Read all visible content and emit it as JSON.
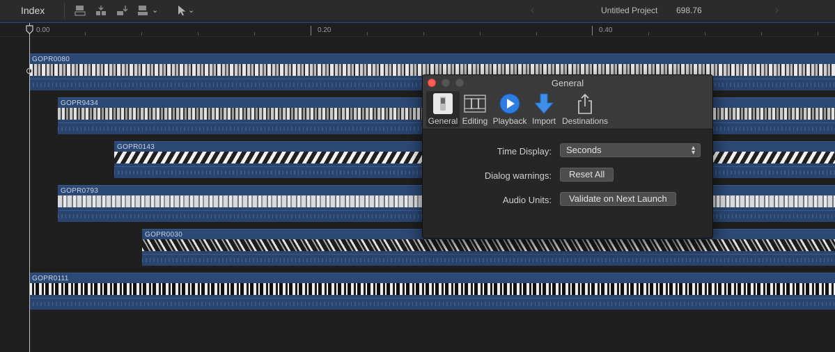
{
  "toolbar": {
    "index_label": "Index",
    "project_title": "Untitled Project",
    "project_duration": "698.76",
    "icons": [
      "connect-clip-icon",
      "insert-clip-icon",
      "append-clip-icon",
      "overwrite-clip-icon",
      "select-tool-icon"
    ]
  },
  "ruler": {
    "marks": [
      "0.00",
      "0.20",
      "0.40"
    ]
  },
  "clips": [
    {
      "name": "GOPR0080"
    },
    {
      "name": "GOPR9434"
    },
    {
      "name": "GOPR0143"
    },
    {
      "name": "GOPR0793"
    },
    {
      "name": "GOPR0030"
    },
    {
      "name": "GOPR0111"
    }
  ],
  "preferences": {
    "title": "General",
    "tabs": [
      {
        "label": "General",
        "icon": "switch-icon",
        "active": true
      },
      {
        "label": "Editing",
        "icon": "film-editing-icon"
      },
      {
        "label": "Playback",
        "icon": "play-icon"
      },
      {
        "label": "Import",
        "icon": "import-arrow-icon"
      },
      {
        "label": "Destinations",
        "icon": "share-icon"
      }
    ],
    "time_display": {
      "label": "Time Display:",
      "value": "Seconds"
    },
    "dialog_warnings": {
      "label": "Dialog warnings:",
      "button": "Reset All"
    },
    "audio_units": {
      "label": "Audio Units:",
      "button": "Validate on Next Launch"
    }
  },
  "colors": {
    "clip_blue": "#2c4874",
    "toolbar_bg": "#2b2b2b",
    "timeline_bg": "#1f1f1f",
    "close_red": "#fc5d56",
    "accent_blue": "#2f7de1"
  }
}
